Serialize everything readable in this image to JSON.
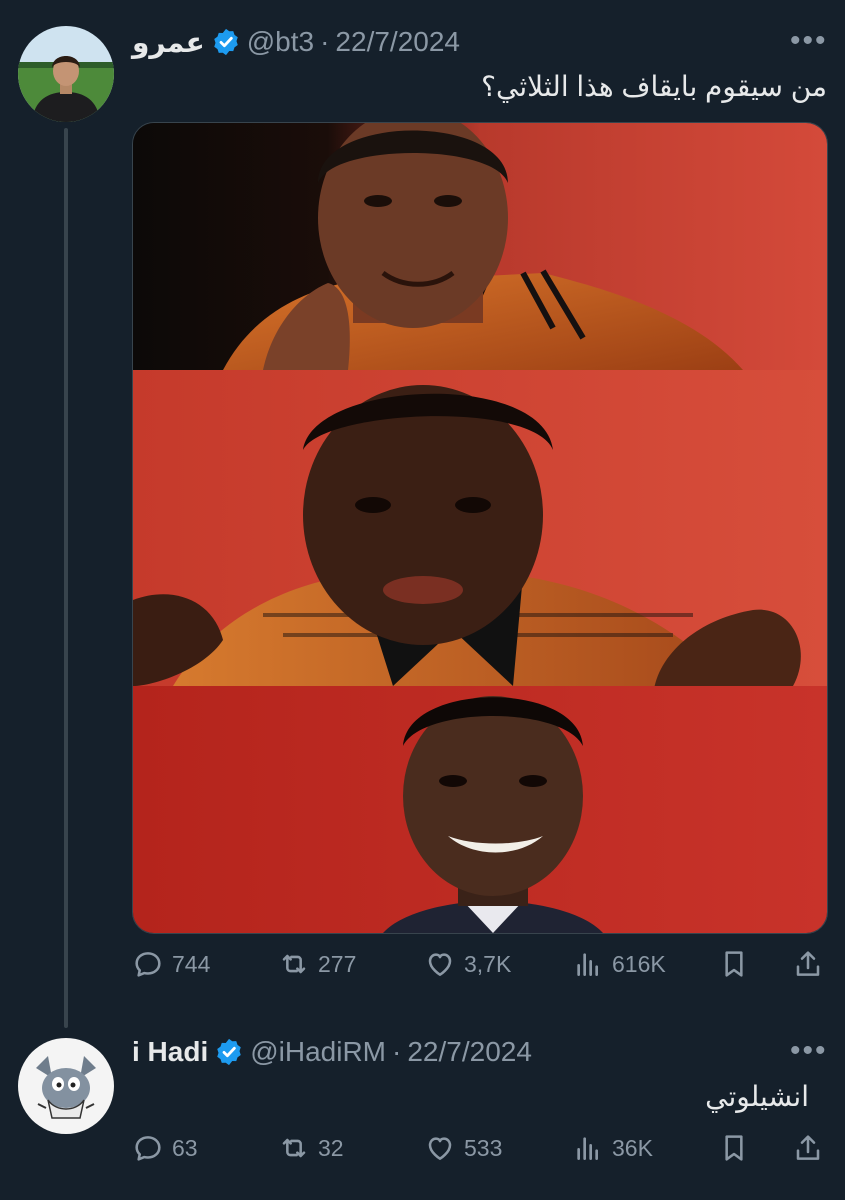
{
  "tweets": [
    {
      "display_name": "عمرو",
      "handle": "@bt3",
      "separator": "·",
      "date": "22/7/2024",
      "more": "•••",
      "text": "من سيقوم بايقاف هذا الثلاثي؟",
      "stats": {
        "replies": "744",
        "reposts": "277",
        "likes": "3,7K",
        "views": "616K"
      }
    },
    {
      "display_name": "i Hadi",
      "handle": "@iHadiRM",
      "separator": "·",
      "date": "22/7/2024",
      "more": "•••",
      "text": "انشيلوتي",
      "stats": {
        "replies": "63",
        "reposts": "32",
        "likes": "533",
        "views": "36K"
      }
    }
  ],
  "colors": {
    "background": "#15202b",
    "verified": "#1d9bf0",
    "muted": "#8b98a5",
    "text": "#e7e9ea"
  },
  "icons": [
    "verified-badge-icon",
    "reply-icon",
    "repost-icon",
    "like-icon",
    "views-icon",
    "bookmark-icon",
    "share-icon",
    "more-icon"
  ]
}
